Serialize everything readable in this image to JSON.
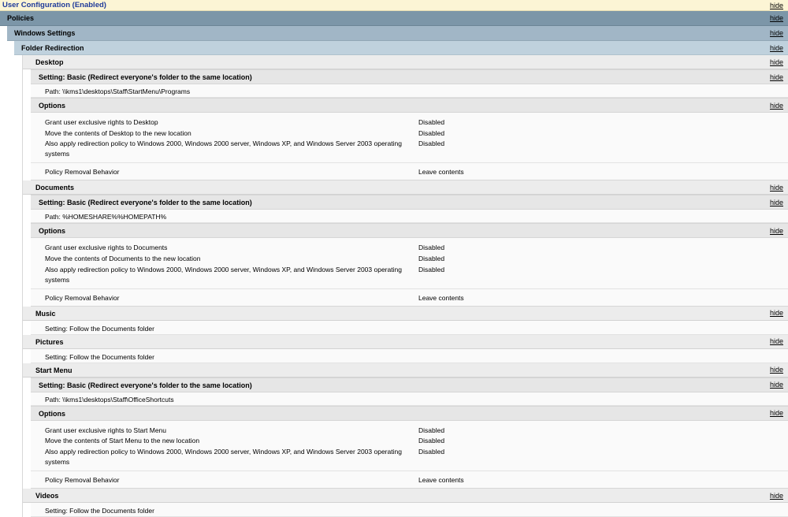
{
  "hide_label": "hide",
  "user_config": "User Configuration (Enabled)",
  "policies": "Policies",
  "windows_settings": "Windows Settings",
  "folder_redirection": "Folder Redirection",
  "desktop": {
    "title": "Desktop",
    "setting": "Setting: Basic (Redirect everyone's folder to the same location)",
    "path": "Path: \\\\kms1\\desktops\\Staff\\StartMenu\\Programs",
    "options_title": "Options",
    "options": [
      {
        "label": "Grant user exclusive rights to Desktop",
        "value": "Disabled"
      },
      {
        "label": "Move the contents of Desktop to the new location",
        "value": "Disabled"
      },
      {
        "label": "Also apply redirection policy to Windows 2000, Windows 2000 server, Windows XP, and Windows Server 2003 operating systems",
        "value": "Disabled"
      }
    ],
    "removal_label": "Policy Removal Behavior",
    "removal_value": "Leave contents"
  },
  "documents": {
    "title": "Documents",
    "setting": "Setting: Basic (Redirect everyone's folder to the same location)",
    "path": "Path: %HOMESHARE%%HOMEPATH%",
    "options_title": "Options",
    "options": [
      {
        "label": "Grant user exclusive rights to Documents",
        "value": "Disabled"
      },
      {
        "label": "Move the contents of Documents to the new location",
        "value": "Disabled"
      },
      {
        "label": "Also apply redirection policy to Windows 2000, Windows 2000 server, Windows XP, and Windows Server 2003 operating systems",
        "value": "Disabled"
      }
    ],
    "removal_label": "Policy Removal Behavior",
    "removal_value": "Leave contents"
  },
  "music": {
    "title": "Music",
    "setting": "Setting: Follow the Documents folder"
  },
  "pictures": {
    "title": "Pictures",
    "setting": "Setting: Follow the Documents folder"
  },
  "start_menu": {
    "title": "Start Menu",
    "setting": "Setting: Basic (Redirect everyone's folder to the same location)",
    "path": "Path: \\\\kms1\\desktops\\Staff\\OfficeShortcuts",
    "options_title": "Options",
    "options": [
      {
        "label": "Grant user exclusive rights to Start Menu",
        "value": "Disabled"
      },
      {
        "label": "Move the contents of Start Menu to the new location",
        "value": "Disabled"
      },
      {
        "label": "Also apply redirection policy to Windows 2000, Windows 2000 server, Windows XP, and Windows Server 2003 operating systems",
        "value": "Disabled"
      }
    ],
    "removal_label": "Policy Removal Behavior",
    "removal_value": "Leave contents"
  },
  "videos": {
    "title": "Videos",
    "setting": "Setting: Follow the Documents folder"
  }
}
